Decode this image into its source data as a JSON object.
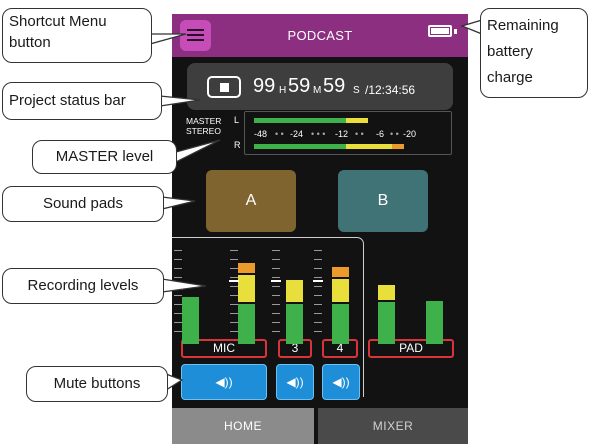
{
  "callouts": {
    "shortcut_menu": "Shortcut Menu button",
    "project_status": "Project status bar",
    "master_level": "MASTER level",
    "sound_pads": "Sound pads",
    "recording_levels": "Recording levels",
    "mute_buttons": "Mute buttons",
    "battery": "Remaining battery charge"
  },
  "header": {
    "title": "PODCAST",
    "menu_icon": "hamburger-icon",
    "battery_icon": "battery-icon"
  },
  "status": {
    "hours": "99",
    "h_unit": "H",
    "minutes": "59",
    "m_unit": "M",
    "seconds": "59",
    "s_unit": "S",
    "max_time": "/12:34:56",
    "stop_icon": "stop-icon"
  },
  "master": {
    "label_line1": "MASTER",
    "label_line2": "STEREO",
    "l": "L",
    "r": "R",
    "scale": [
      "-48",
      "-24",
      "-12",
      "-6",
      "-20"
    ],
    "l_level_fraction": 0.76,
    "r_level_fraction": 0.88
  },
  "pads": [
    {
      "label": "A",
      "color": "#7f6430"
    },
    {
      "label": "B",
      "color": "#3f7375"
    }
  ],
  "channels": {
    "labels": [
      "MIC",
      "3",
      "4",
      "PAD"
    ],
    "mute_icon": "speaker-icon",
    "mute_glyph": "◀))"
  },
  "tabs": [
    "HOME",
    "MIXER"
  ],
  "colors": {
    "header": "#8c2f80",
    "level_green": "#3fb14a",
    "level_yellow": "#e8df3c",
    "level_orange": "#ec9a2c",
    "mute_blue": "#1f8ed8",
    "label_red": "#d9343a"
  }
}
